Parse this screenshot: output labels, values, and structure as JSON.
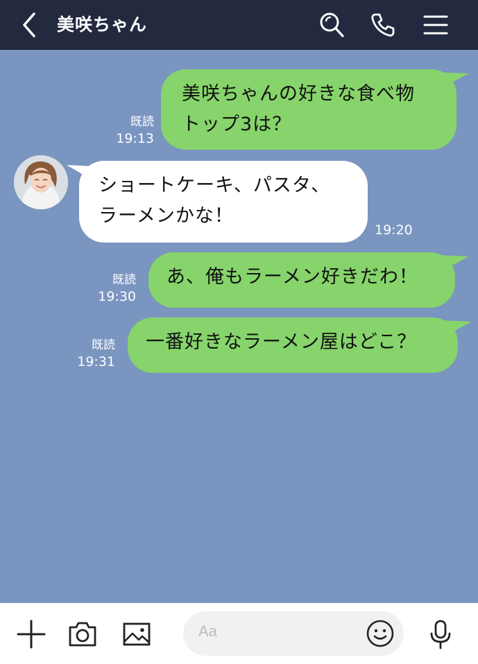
{
  "header": {
    "title": "美咲ちゃん",
    "icons": [
      "back-chevron-icon",
      "search-icon",
      "phone-icon",
      "menu-icon"
    ],
    "background": "#232a3f"
  },
  "chat": {
    "background": "#7a95c0",
    "messages": [
      {
        "sender": "me",
        "lines": [
          "美咲ちゃんの好きな食べ物",
          "トップ3は？"
        ],
        "read": "既読",
        "time": "19:13"
      },
      {
        "sender": "other",
        "lines": [
          "ショートケーキ、パスタ、",
          "ラーメンかな！"
        ],
        "time": "19:20"
      },
      {
        "sender": "me",
        "lines": [
          "あ、俺もラーメン好きだわ！"
        ],
        "read": "既読",
        "time": "19:30"
      },
      {
        "sender": "me",
        "lines": [
          "一番好きなラーメン屋はどこ？"
        ],
        "read": "既読",
        "time": "19:31"
      }
    ]
  },
  "footer": {
    "input_placeholder": "Aa",
    "icons": [
      "plus-icon",
      "camera-icon",
      "image-icon",
      "emoji-icon",
      "microphone-icon"
    ]
  },
  "colors": {
    "my_bubble": "#86d46b",
    "other_bubble": "#ffffff",
    "footer": "#ffffff"
  }
}
